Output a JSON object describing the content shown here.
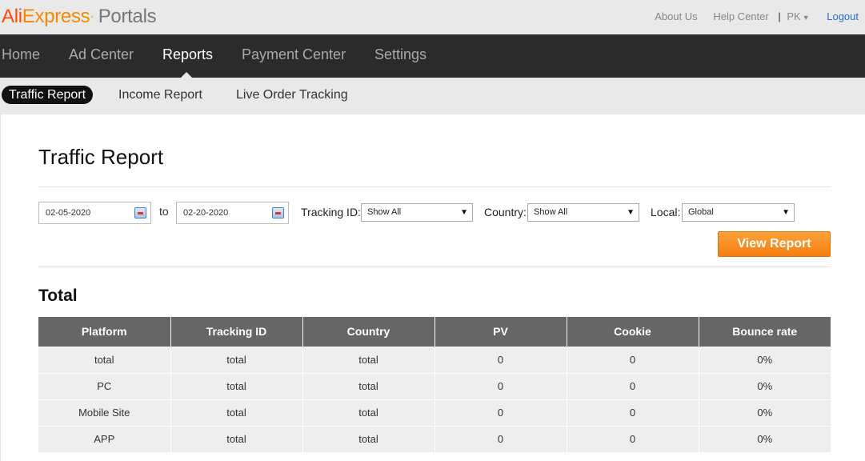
{
  "header": {
    "logo_ali": "Ali",
    "logo_express": "Express",
    "logo_tm": "°",
    "logo_portals": "Portals",
    "about_us": "About Us",
    "help_center": "Help Center",
    "separator": "|",
    "language": "PK",
    "logout": "Logout"
  },
  "nav": {
    "items": [
      {
        "label": "Home"
      },
      {
        "label": "Ad Center"
      },
      {
        "label": "Reports"
      },
      {
        "label": "Payment Center"
      },
      {
        "label": "Settings"
      }
    ],
    "active": "Reports"
  },
  "subnav": {
    "items": [
      {
        "label": "Traffic Report"
      },
      {
        "label": "Income Report"
      },
      {
        "label": "Live Order Tracking"
      }
    ],
    "active": "Traffic Report"
  },
  "page": {
    "title": "Traffic Report"
  },
  "filters": {
    "start_date": "02-05-2020",
    "to_label": "to",
    "end_date": "02-20-2020",
    "tracking_label": "Tracking ID:",
    "tracking_value": "Show All",
    "country_label": "Country:",
    "country_value": "Show All",
    "local_label": "Local:",
    "local_value": "Global",
    "view_button": "View Report"
  },
  "total": {
    "title": "Total",
    "columns": [
      "Platform",
      "Tracking ID",
      "Country",
      "PV",
      "Cookie",
      "Bounce rate"
    ],
    "rows": [
      [
        "total",
        "total",
        "total",
        "0",
        "0",
        "0%"
      ],
      [
        "PC",
        "total",
        "total",
        "0",
        "0",
        "0%"
      ],
      [
        "Mobile Site",
        "total",
        "total",
        "0",
        "0",
        "0%"
      ],
      [
        "APP",
        "total",
        "total",
        "0",
        "0",
        "0%"
      ]
    ]
  },
  "colors": {
    "brand_red": "#ff4a00",
    "brand_orange": "#f08a00",
    "button_orange": "#f57d10",
    "nav_bg": "#2b2b2b",
    "table_header": "#666666",
    "link_blue": "#2a6fc9"
  },
  "icons": {
    "calendar": "calendar-icon",
    "dropdown": "chevron-down-icon",
    "language_caret": "caret-down-icon"
  }
}
